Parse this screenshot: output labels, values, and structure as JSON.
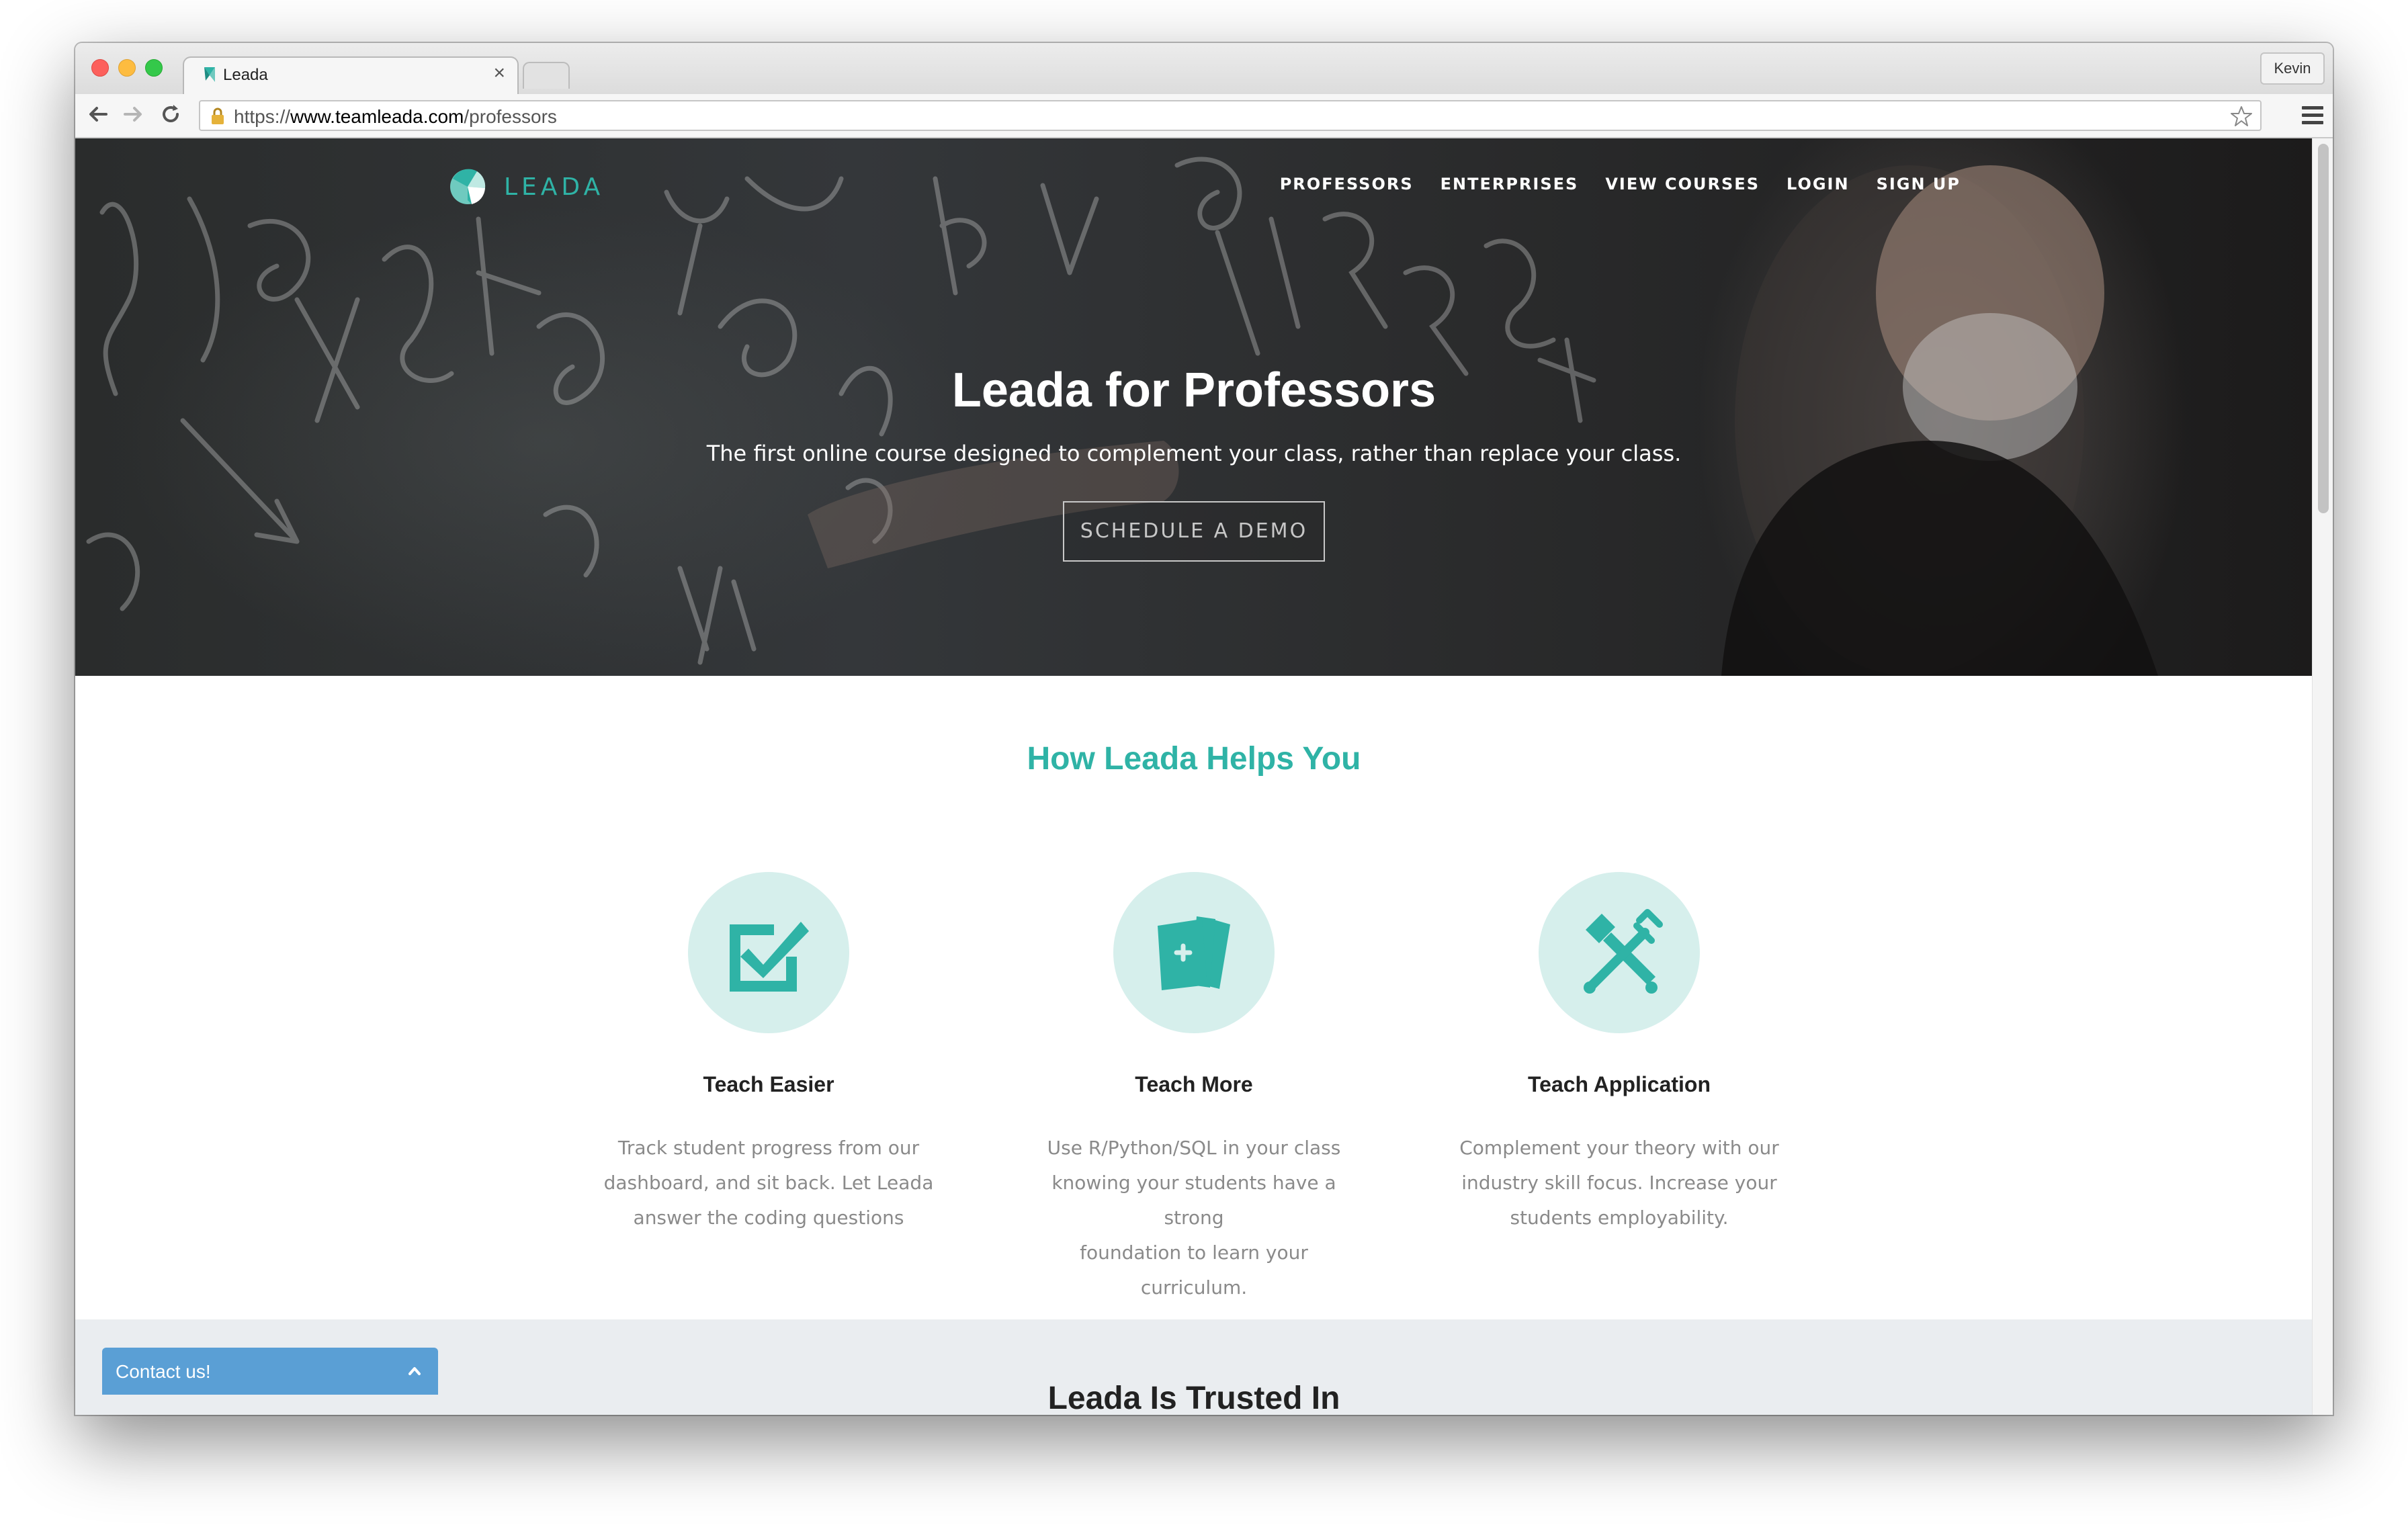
{
  "browser": {
    "tab_title": "Leada",
    "tab_close": "×",
    "profile_name": "Kevin",
    "url_scheme": "https://",
    "url_host": "www.teamleada.com",
    "url_path": "/professors"
  },
  "header": {
    "logo_text": "LEADA",
    "nav": [
      "PROFESSORS",
      "ENTERPRISES",
      "VIEW COURSES",
      "LOGIN",
      "SIGN UP"
    ]
  },
  "hero": {
    "title": "Leada for Professors",
    "subtitle": "The first online course designed to complement your class, rather than replace your class.",
    "cta": "SCHEDULE A DEMO"
  },
  "helps": {
    "title": "How Leada Helps You",
    "features": [
      {
        "icon": "checkbox-icon",
        "title": "Teach Easier",
        "desc": [
          "Track student progress from our",
          "dashboard, and sit back. Let Leada",
          "answer the coding questions"
        ]
      },
      {
        "icon": "cards-icon",
        "title": "Teach More",
        "desc": [
          "Use R/Python/SQL in your class",
          "knowing your students have a strong",
          "foundation to learn your curriculum."
        ]
      },
      {
        "icon": "tools-icon",
        "title": "Teach Application",
        "desc": [
          "Complement your theory with our",
          "industry skill focus. Increase your",
          "students employability."
        ]
      }
    ]
  },
  "trusted": {
    "title": "Leada Is Trusted In"
  },
  "contact": {
    "label": "Contact us!"
  },
  "colors": {
    "accent": "#2fb3a6",
    "icon_bg": "#d6efec",
    "contact_bg": "#5a9fd5",
    "trusted_bg": "#eaedf0"
  }
}
